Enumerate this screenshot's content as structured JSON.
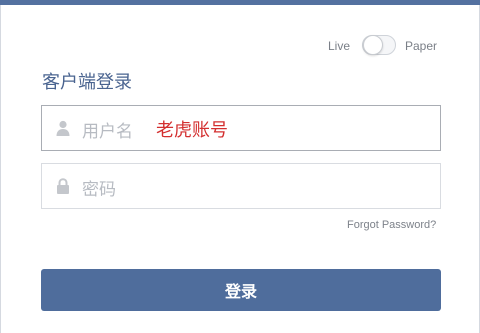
{
  "mode_toggle": {
    "left_label": "Live",
    "right_label": "Paper"
  },
  "login": {
    "title": "客户端登录",
    "username_placeholder": "用户名",
    "username_value": "老虎账号",
    "password_placeholder": "密码",
    "forgot_label": "Forgot Password?",
    "submit_label": "登录"
  },
  "colors": {
    "accent": "#4f6d9c",
    "value_text": "#d32f2f"
  },
  "icons": {
    "username": "user-icon",
    "password": "lock-icon"
  }
}
